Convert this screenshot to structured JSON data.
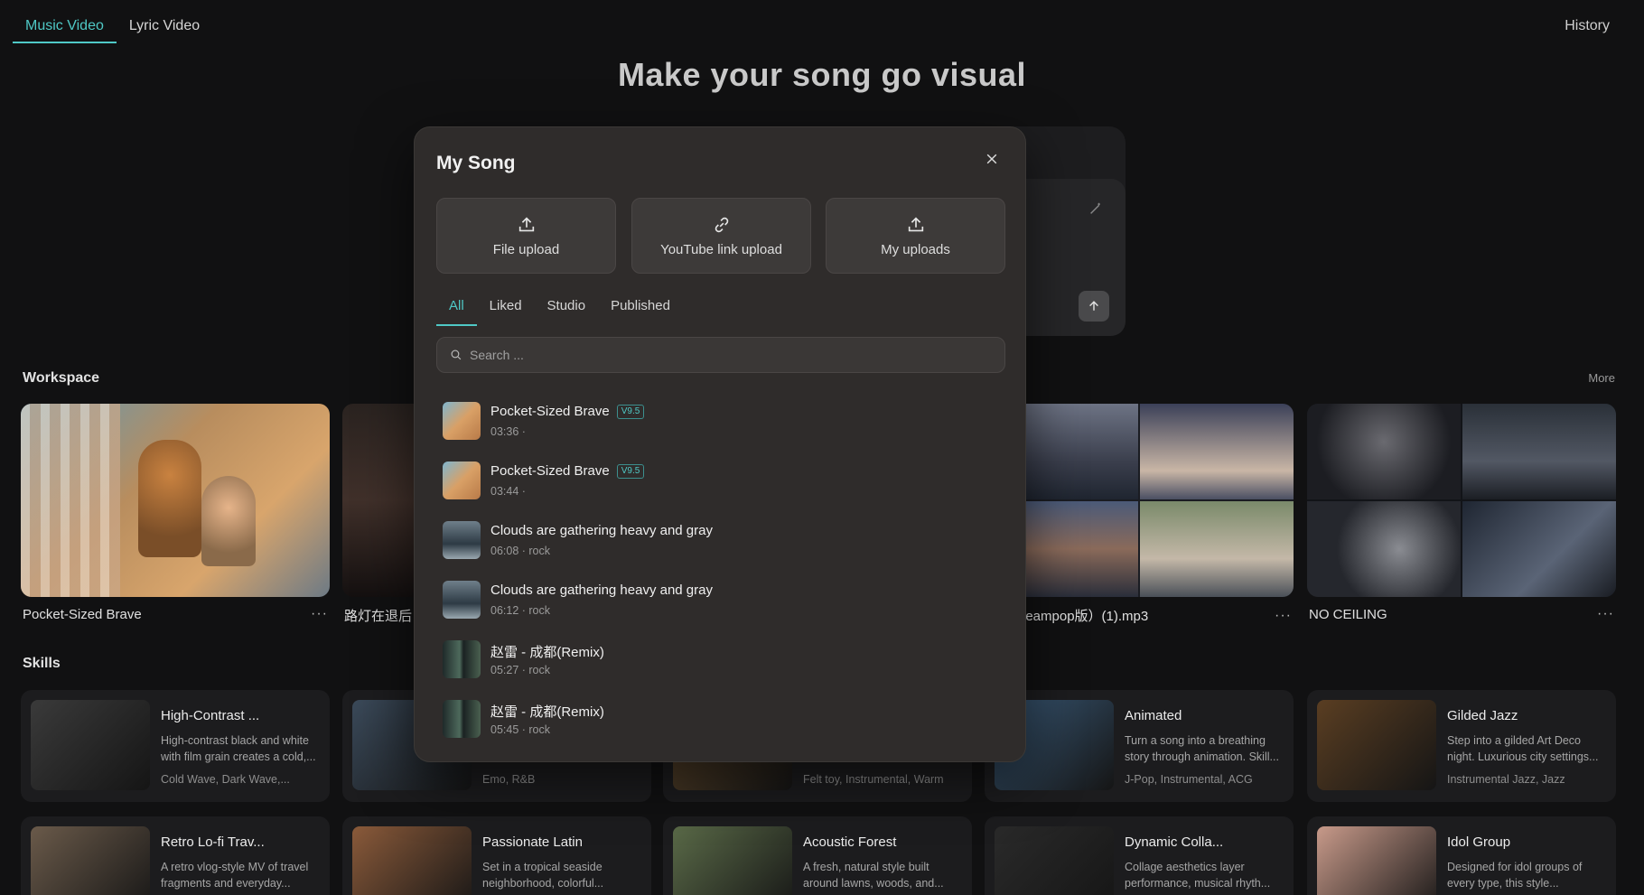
{
  "nav": {
    "tabs": [
      "Music Video",
      "Lyric Video"
    ],
    "active": 0,
    "history": "History"
  },
  "hero": {
    "title": "Make your song go visual"
  },
  "workspace": {
    "title": "Workspace",
    "more": "More",
    "items": [
      {
        "label": "Pocket-Sized Brave"
      },
      {
        "label": "路灯在退后"
      },
      {
        "label": "歌（dreampop版）(1).mp3"
      },
      {
        "label": "NO CEILING"
      }
    ],
    "dots": "···"
  },
  "skills": {
    "title": "Skills",
    "items": [
      {
        "title": "High-Contrast ...",
        "desc": "High-contrast black and white with film grain creates a cold,...",
        "tags": "Cold Wave, Dark Wave,...",
        "color": "#3a3a3a"
      },
      {
        "title": "",
        "desc": "",
        "tags": "Emo, R&B",
        "color": "#3b4a5a"
      },
      {
        "title": "",
        "desc": "",
        "tags": "Felt toy, Instrumental, Warm",
        "color": "#6a5030"
      },
      {
        "title": "Animated",
        "desc": "Turn a song into a breathing story through animation. Skill...",
        "tags": "J-Pop, Instrumental, ACG",
        "color": "#3a5a78"
      },
      {
        "title": "Gilded Jazz",
        "desc": "Step into a gilded Art Deco night. Luxurious city settings...",
        "tags": "Instrumental Jazz, Jazz",
        "color": "#5a3e22"
      },
      {
        "title": "Retro Lo-fi Trav...",
        "desc": "A retro vlog-style MV of travel fragments and everyday...",
        "tags": "",
        "color": "#6a5a4a"
      },
      {
        "title": "Passionate Latin",
        "desc": "Set in a tropical seaside neighborhood, colorful...",
        "tags": "",
        "color": "#8a5a3a"
      },
      {
        "title": "Acoustic Forest",
        "desc": "A fresh, natural style built around lawns, woods, and...",
        "tags": "",
        "color": "#5a6a48"
      },
      {
        "title": "Dynamic Colla...",
        "desc": "Collage aesthetics layer performance, musical rhyth...",
        "tags": "",
        "color": "#2a2a2a"
      },
      {
        "title": "Idol Group",
        "desc": "Designed for idol groups of every type, this style...",
        "tags": "",
        "color": "#c89a8a"
      }
    ]
  },
  "modal": {
    "title": "My Song",
    "uploads": [
      "File upload",
      "YouTube link upload",
      "My uploads"
    ],
    "tabs": [
      "All",
      "Liked",
      "Studio",
      "Published"
    ],
    "active_tab": 0,
    "search_placeholder": "Search ...",
    "songs": [
      {
        "title": "Pocket-Sized Brave",
        "badge": "V9.5",
        "meta": "03:36 ·"
      },
      {
        "title": "Pocket-Sized Brave",
        "badge": "V9.5",
        "meta": "03:44 ·"
      },
      {
        "title": "Clouds are gathering heavy and gray",
        "badge": "",
        "meta": "06:08 · rock"
      },
      {
        "title": "Clouds are gathering heavy and gray",
        "badge": "",
        "meta": "06:12 · rock"
      },
      {
        "title": "赵雷 - 成都(Remix)",
        "badge": "",
        "meta": "05:27 · rock"
      },
      {
        "title": "赵雷 - 成都(Remix)",
        "badge": "",
        "meta": "05:45 · rock"
      }
    ]
  },
  "colors": {
    "accent": "#4fc9c6",
    "background": "#111112",
    "modal": "#2f2c2b"
  }
}
